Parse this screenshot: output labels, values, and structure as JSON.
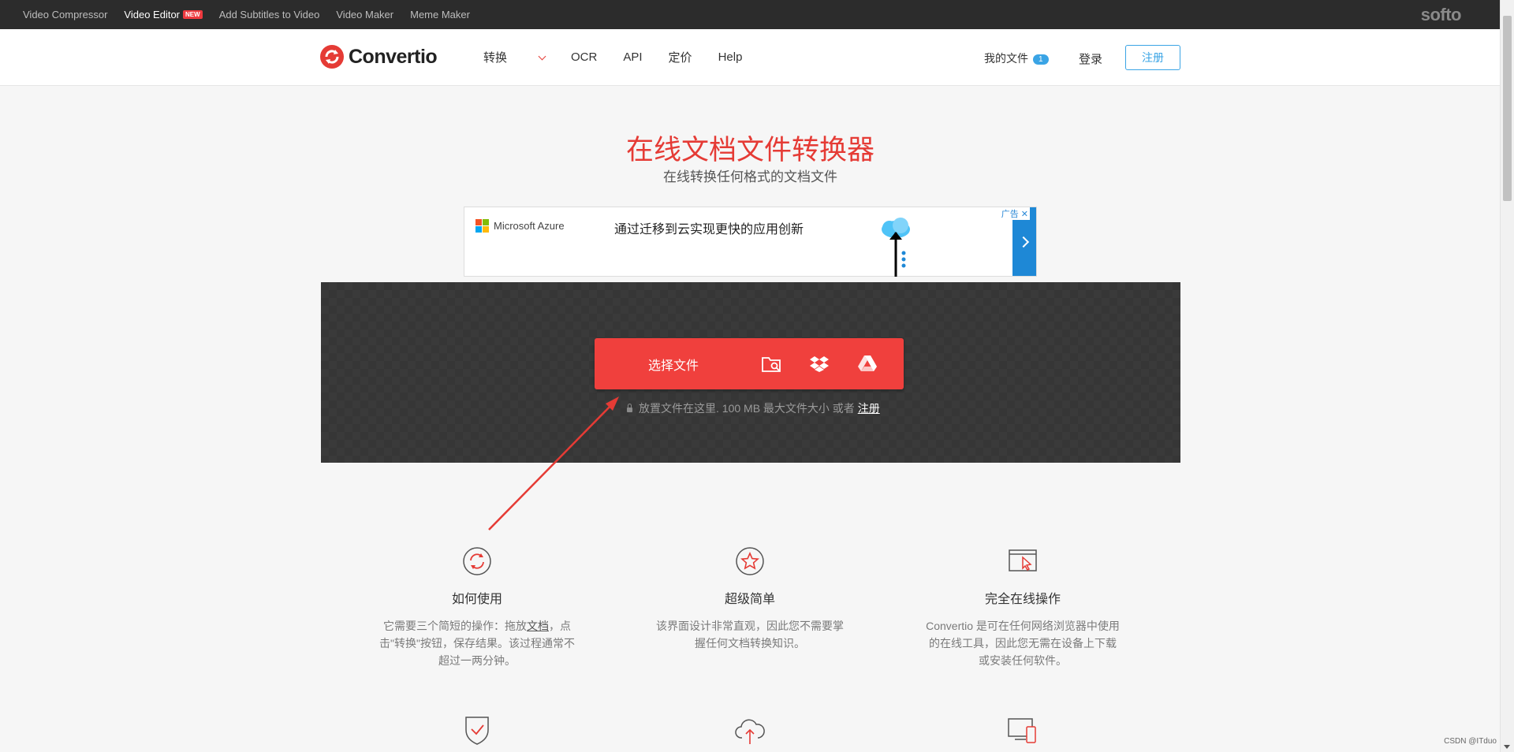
{
  "topbar": {
    "links": [
      "Video Compressor",
      "Video Editor",
      "Add Subtitles to Video",
      "Video Maker",
      "Meme Maker"
    ],
    "new_badge": "NEW",
    "brand": "softo"
  },
  "header": {
    "logo_text": "Convertio",
    "nav": [
      "转换",
      "OCR",
      "API",
      "定价",
      "Help"
    ],
    "my_files": "我的文件",
    "my_files_count": "1",
    "login": "登录",
    "signup": "注册"
  },
  "hero": {
    "title": "在线文档文件转换器",
    "subtitle": "在线转换任何格式的文档文件"
  },
  "ad": {
    "brand": "Microsoft Azure",
    "text": "通过迁移到云实现更快的应用创新",
    "label": "广告"
  },
  "upload": {
    "choose_label": "选择文件",
    "drop_text": "放置文件在这里. 100 MB 最大文件大小 或者",
    "signup_link": "注册",
    "icons": [
      "folder-search-icon",
      "dropbox-icon",
      "google-drive-icon"
    ]
  },
  "features": [
    {
      "icon": "refresh-icon",
      "title": "如何使用",
      "desc_before": "它需要三个简短的操作：拖放",
      "desc_link": "文档",
      "desc_after": "，点击\"转换\"按钮，保存结果。该过程通常不超过一两分钟。"
    },
    {
      "icon": "star-icon",
      "title": "超级简单",
      "desc": "该界面设计非常直观，因此您不需要掌握任何文档转换知识。"
    },
    {
      "icon": "browser-cursor-icon",
      "title": "完全在线操作",
      "desc": "Convertio 是可在任何网络浏览器中使用的在线工具，因此您无需在设备上下载或安装任何软件。"
    }
  ],
  "features_row2_icons": [
    "shield-check-icon",
    "cloud-upload-icon",
    "devices-icon"
  ],
  "watermark": "CSDN @ITduo",
  "colors": {
    "accent": "#f0403d",
    "link": "#3aa4e5",
    "topbar": "#2c2c2c"
  }
}
